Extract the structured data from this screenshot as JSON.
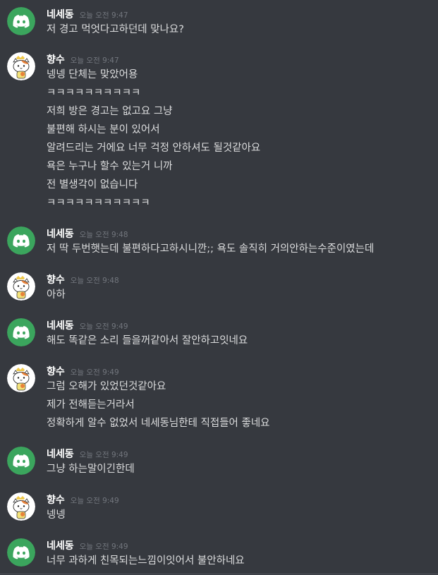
{
  "users": {
    "discord_user": {
      "name": "네세동",
      "avatar_color": "#3ba55d",
      "avatar_icon": "discord-logo-icon"
    },
    "cat_user": {
      "name": "향수",
      "avatar_icon": "cat-avatar-icon"
    }
  },
  "messages": [
    {
      "author": "네세동",
      "avatar": "discord",
      "time": "오늘 오전 9:47",
      "lines": [
        "저 경고 먹엇다고하던데 맞나요?"
      ]
    },
    {
      "author": "향수",
      "avatar": "cat",
      "time": "오늘 오전 9:47",
      "lines": [
        "넹넹 단체는 맞았어용",
        "ㅋㅋㅋㅋㅋㅋㅋㅋㅋㅋ",
        "저희 방은 경고는 없고요 그냥",
        "불편해 하시는 분이 있어서",
        "알려드리는 거에요 너무 걱정 안하셔도 될것같아요",
        "욕은 누구나 할수 있는거 니까",
        "전 별생각이 없습니다",
        "ㅋㅋㅋㅋㅋㅋㅋㅋㅋㅋㅋ"
      ]
    },
    {
      "author": "네세동",
      "avatar": "discord",
      "time": "오늘 오전 9:48",
      "lines": [
        "저 딱 두번햇는데 불편하다고하시니깐;; 욕도 솔직히 거의안하는수준이였는데"
      ]
    },
    {
      "author": "향수",
      "avatar": "cat",
      "time": "오늘 오전 9:48",
      "lines": [
        "아하"
      ]
    },
    {
      "author": "네세동",
      "avatar": "discord",
      "time": "오늘 오전 9:49",
      "lines": [
        "해도 똑같은 소리 들을꺼같아서 잘안하고잇네요"
      ]
    },
    {
      "author": "향수",
      "avatar": "cat",
      "time": "오늘 오전 9:49",
      "lines": [
        "그럼 오해가 있었던것같아요",
        "제가 전해듣는거라서",
        "정확하게 알수 없었서 네세동님한테 직접들어 좋네요"
      ]
    },
    {
      "author": "네세동",
      "avatar": "discord",
      "time": "오늘 오전 9:49",
      "lines": [
        "그냥 하는말이긴한데"
      ]
    },
    {
      "author": "향수",
      "avatar": "cat",
      "time": "오늘 오전 9:49",
      "lines": [
        "넹넹"
      ]
    },
    {
      "author": "네세동",
      "avatar": "discord",
      "time": "오늘 오전 9:49",
      "lines": [
        "너무 과하게 친목되는느낌이잇어서 불안하네요"
      ]
    }
  ]
}
